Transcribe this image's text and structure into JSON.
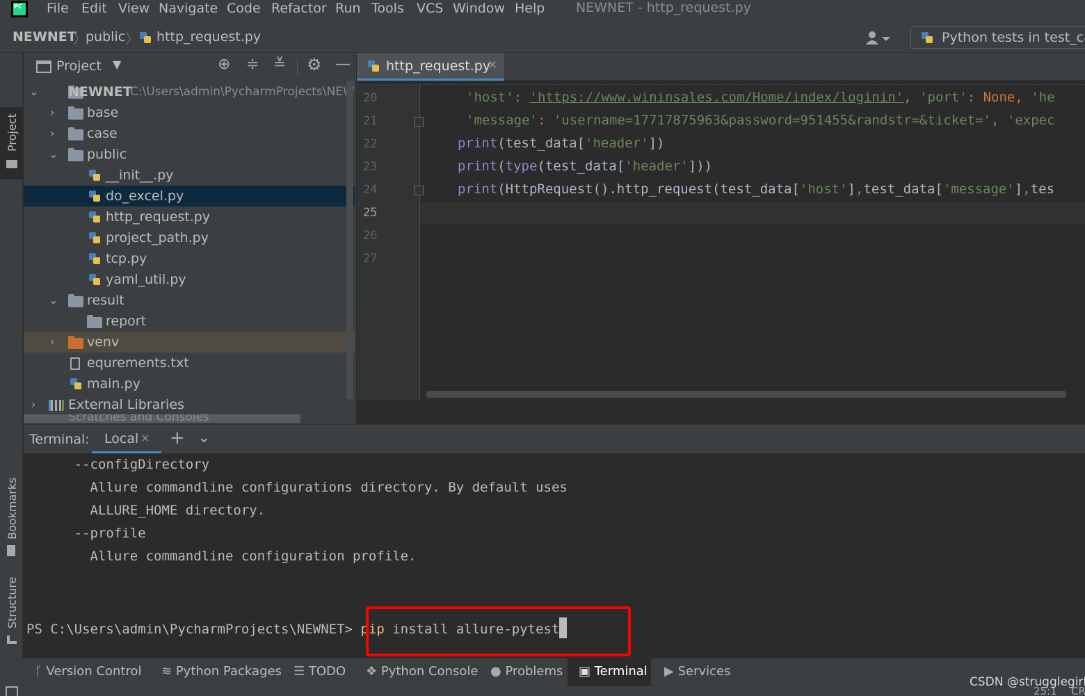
{
  "window": {
    "title": "NEWNET - http_request.py",
    "logo": "PC"
  },
  "menu": [
    "File",
    "Edit",
    "View",
    "Navigate",
    "Code",
    "Refactor",
    "Run",
    "Tools",
    "VCS",
    "Window",
    "Help"
  ],
  "navbar": {
    "project": "NEWNET",
    "folder": "public",
    "file": "http_request.py",
    "run_config": "Python tests in test_case"
  },
  "left_strip": {
    "project": "Project",
    "bookmarks": "Bookmarks",
    "structure": "Structure"
  },
  "project_panel": {
    "title": "Project",
    "root": {
      "name": "NEWNET",
      "path": "C:\\Users\\admin\\PycharmProjects\\NEW"
    },
    "items": [
      {
        "label": "base",
        "type": "folder",
        "expanded": false
      },
      {
        "label": "case",
        "type": "folder",
        "expanded": false
      },
      {
        "label": "public",
        "type": "folder",
        "expanded": true
      },
      {
        "label": "__init__.py",
        "type": "python"
      },
      {
        "label": "do_excel.py",
        "type": "python"
      },
      {
        "label": "http_request.py",
        "type": "python"
      },
      {
        "label": "project_path.py",
        "type": "python"
      },
      {
        "label": "tcp.py",
        "type": "python"
      },
      {
        "label": "yaml_util.py",
        "type": "python"
      },
      {
        "label": "result",
        "type": "folder",
        "expanded": true
      },
      {
        "label": "report",
        "type": "folder"
      },
      {
        "label": "venv",
        "type": "folder-excluded",
        "expanded": false
      },
      {
        "label": "equrements.txt",
        "type": "text"
      },
      {
        "label": "main.py",
        "type": "python"
      },
      {
        "label": "External Libraries",
        "type": "library",
        "expanded": false
      }
    ],
    "partial_item": "Scratches and Consoles"
  },
  "editor": {
    "tab": "http_request.py",
    "line_numbers": [
      "20",
      "21",
      "22",
      "23",
      "24",
      "25",
      "26",
      "27"
    ],
    "lines": {
      "l20a": "'host'",
      "l20b": ": ",
      "l20c": "'https://www.wininsales.com/Home/index/loginin'",
      "l20d": ", ",
      "l20e": "'port'",
      "l20f": ": ",
      "l20g": "None",
      "l20h": ", ",
      "l20i": "'he",
      "l21a": "'message'",
      "l21b": ": ",
      "l21c": "'username=17717875963&password=951455&randstr=&ticket='",
      "l21d": ", ",
      "l21e": "'expec",
      "l22a": "print",
      "l22b": "(test_data[",
      "l22c": "'header'",
      "l22d": "])",
      "l23a": "print",
      "l23b": "(",
      "l23c": "type",
      "l23d": "(test_data[",
      "l23e": "'header'",
      "l23f": "]))",
      "l24a": "print",
      "l24b": "(HttpRequest().http_request(test_data[",
      "l24c": "'host'",
      "l24d": "]",
      "l24e": ",",
      "l24f": "test_data[",
      "l24g": "'message'",
      "l24h": "]",
      "l24i": ",",
      "l24j": "tes"
    }
  },
  "terminal": {
    "title": "Terminal:",
    "tab": "Local",
    "lines": [
      "      --configDirectory",
      "        Allure commandline configurations directory. By default uses",
      "        ALLURE_HOME directory.",
      "      --profile",
      "        Allure commandline configuration profile."
    ],
    "prompt": "PS C:\\Users\\admin\\PycharmProjects\\NEWNET> ",
    "cmd_keyword": "pip",
    "cmd_rest": " install allure-pytest"
  },
  "bottom_tools": [
    "Version Control",
    "Python Packages",
    "TODO",
    "Python Console",
    "Problems",
    "Terminal",
    "Services"
  ],
  "status": {
    "position": "25:1",
    "extra": "CR"
  },
  "watermark": "CSDN @strugglegirl",
  "colors": {
    "keyword": "#8888c6",
    "string": "#6a8759",
    "accent": "#4a88c7",
    "highlight": "#ff0000"
  }
}
